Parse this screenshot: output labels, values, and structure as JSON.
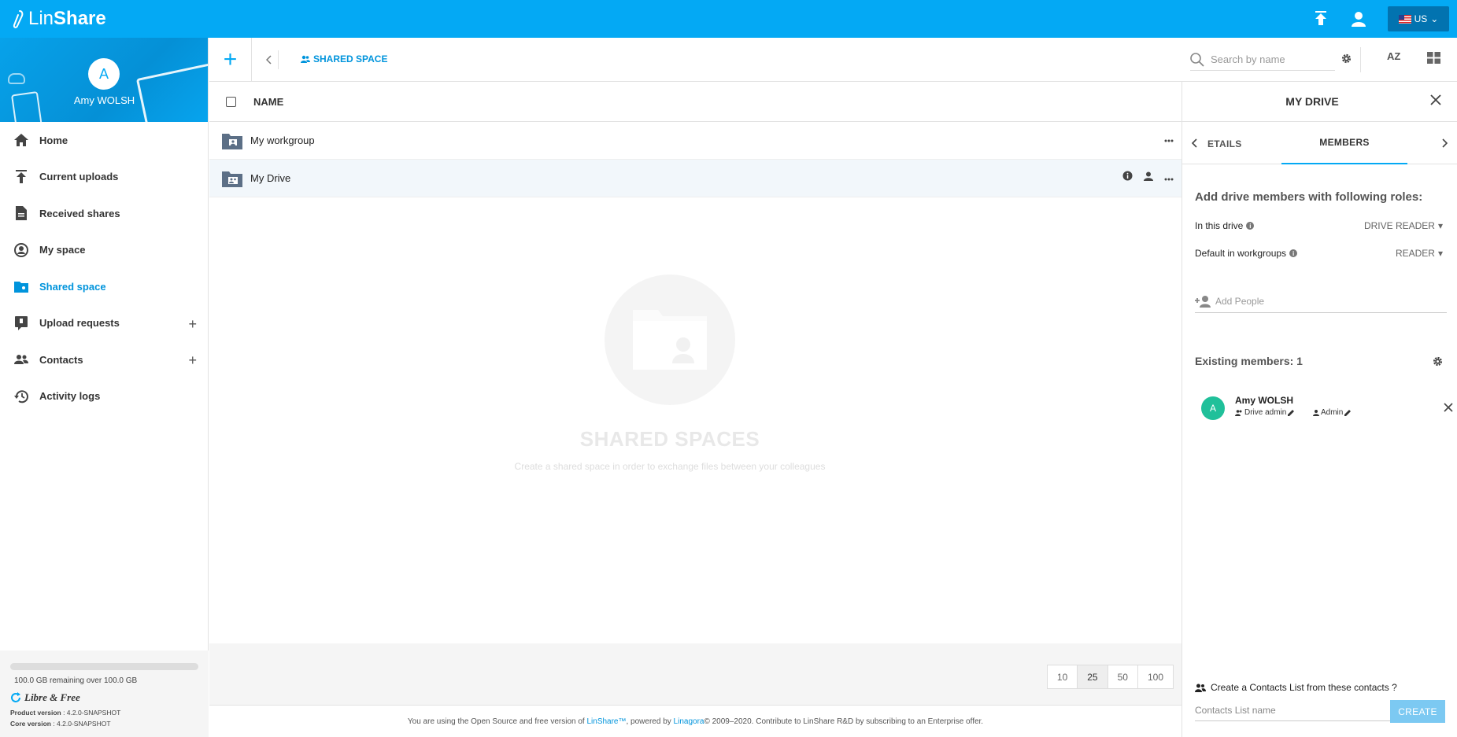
{
  "app": {
    "logo_light": "Lin",
    "logo_bold": "Share"
  },
  "topbar": {
    "language_label": "US"
  },
  "colors": {
    "primary": "#04a9f4",
    "accent_text": "#0094dc",
    "member_avatar": "#20c09a",
    "create_button": "#7cc9f2"
  },
  "profile": {
    "initial": "A",
    "name": "Amy WOLSH"
  },
  "sidebar": {
    "items": [
      {
        "label": "Home",
        "icon": "home-icon"
      },
      {
        "label": "Current uploads",
        "icon": "upload-icon"
      },
      {
        "label": "Received shares",
        "icon": "document-icon"
      },
      {
        "label": "My space",
        "icon": "user-circle-icon"
      },
      {
        "label": "Shared space",
        "icon": "shared-folder-icon",
        "active": true
      },
      {
        "label": "Upload requests",
        "icon": "upload-request-icon"
      },
      {
        "label": "Contacts",
        "icon": "contacts-icon"
      },
      {
        "label": "Activity logs",
        "icon": "history-icon"
      }
    ]
  },
  "quota": {
    "used_fraction": 0.0,
    "text": "100.0 GB remaining over 100.0 GB"
  },
  "brand_footer": {
    "libre_label": "Libre & Free",
    "product_label": "Product version",
    "product_value": " : 4.2.0-SNAPSHOT",
    "core_label": "Core version",
    "core_value": " : 4.2.0-SNAPSHOT"
  },
  "toolbar": {
    "add_label": "+",
    "breadcrumb": "SHARED SPACE",
    "search_placeholder": "Search by name",
    "sort_label": "AZ"
  },
  "list": {
    "column_name": "NAME",
    "rows": [
      {
        "name": "My workgroup"
      },
      {
        "name": "My Drive"
      }
    ],
    "empty_title": "SHARED SPACES",
    "empty_desc": "Create a shared space in order to exchange files between your colleagues"
  },
  "pagination": {
    "options": [
      "10",
      "25",
      "50",
      "100"
    ],
    "selected": "25"
  },
  "footer": {
    "prefix": "You are using the Open Source and free version of ",
    "linshare": "LinShare™",
    "powered": ", powered by ",
    "linagora": "Linagora",
    "suffix": " © 2009–2020. Contribute to LinShare R&D by subscribing to an Enterprise offer."
  },
  "panel": {
    "title": "MY DRIVE",
    "tab_details": "ETAILS",
    "tab_members": "MEMBERS",
    "add_heading": "Add drive members with following roles:",
    "in_drive_label": "In this drive",
    "in_drive_role": "DRIVE READER",
    "default_wg_label": "Default in workgroups",
    "default_wg_role": "READER",
    "add_people_placeholder": "Add People",
    "existing_label": "Existing members: 1",
    "member": {
      "initial": "A",
      "name": "Amy WOLSH",
      "drive_role": "Drive admin",
      "wg_role": "Admin"
    },
    "contacts_list_title": "Create a Contacts List from these contacts ?",
    "contacts_list_placeholder": "Contacts List name",
    "create_label": "CREATE"
  }
}
